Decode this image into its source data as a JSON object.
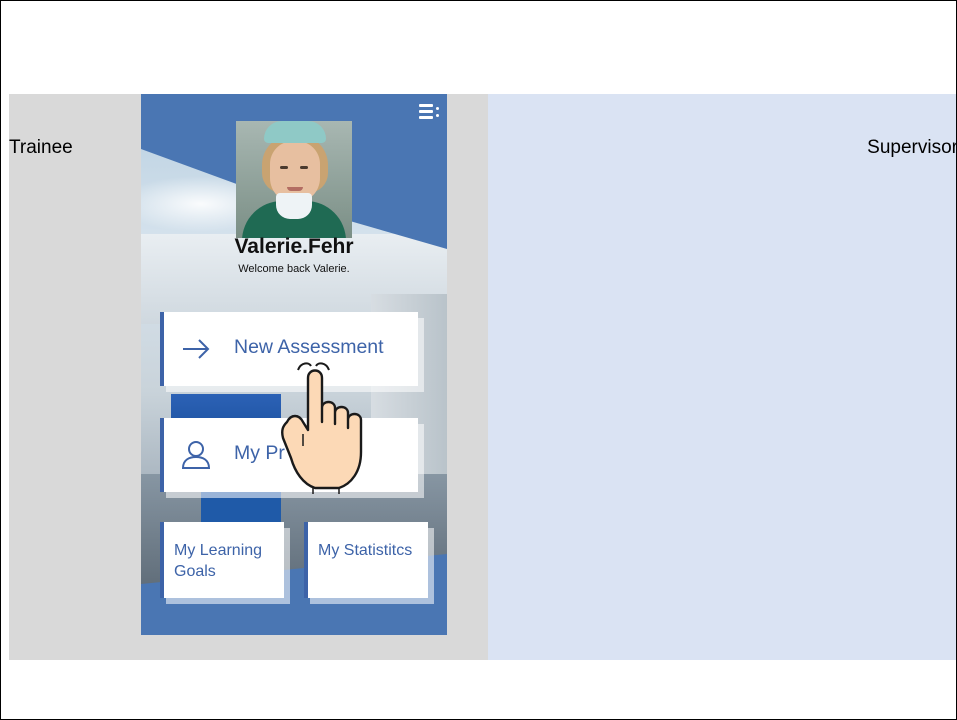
{
  "labels": {
    "trainee": "Trainee",
    "supervisor": "Supervisor"
  },
  "app": {
    "username": "Valerie.Fehr",
    "welcome": "Welcome back Valerie.",
    "menu_icon": "hamburger-menu-icon",
    "buttons": {
      "new_assessment": "New Assessment",
      "my_profile": "My Pr",
      "learning_goals": "My Learning Goals",
      "statistics": "My Statistitcs"
    },
    "icons": {
      "new_assessment": "arrow-right-icon",
      "my_profile": "user-icon"
    }
  },
  "colors": {
    "trainee_bg": "#d9d9d9",
    "supervisor_bg": "#dae3f3",
    "app_blue": "#4a76b3",
    "button_text": "#3d63a8"
  }
}
